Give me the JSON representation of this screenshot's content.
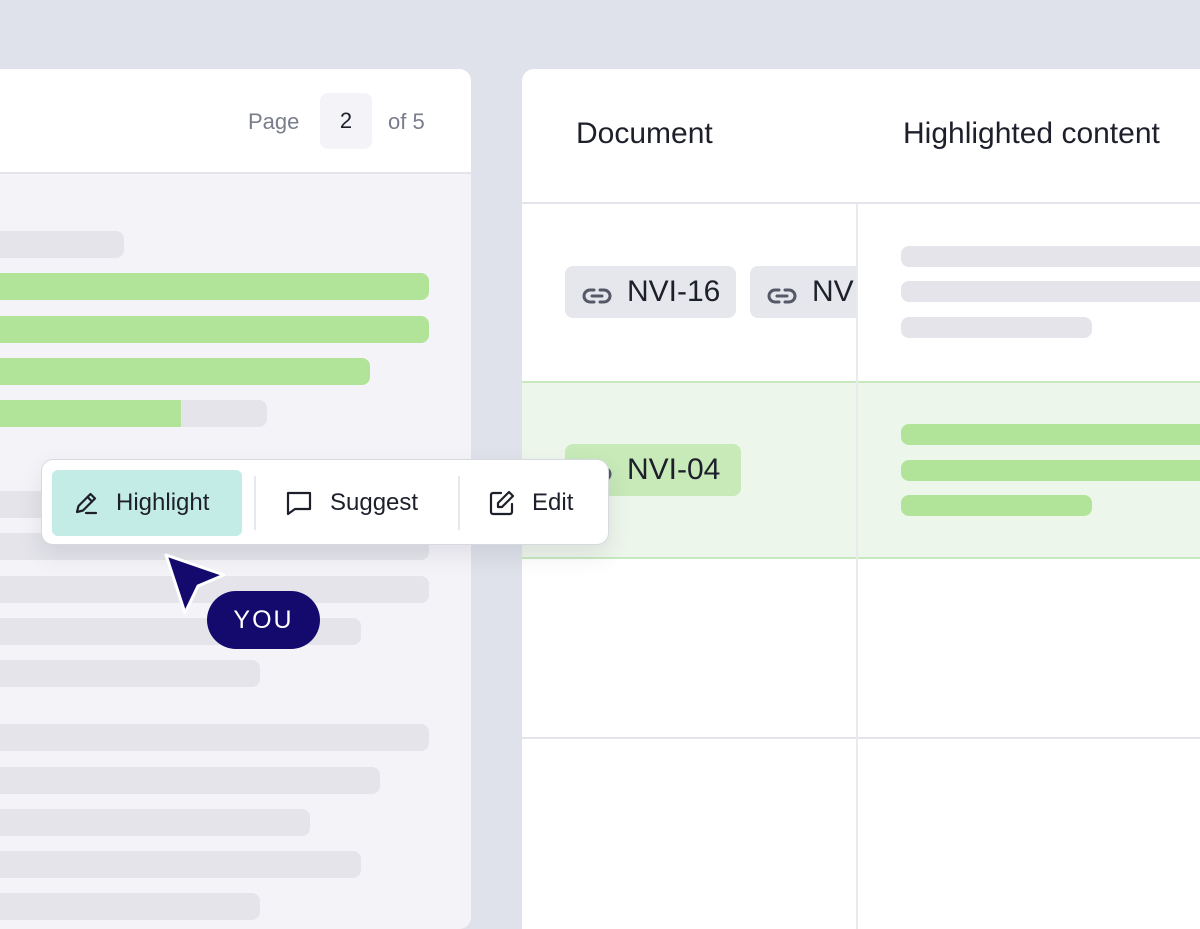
{
  "pager": {
    "page_label": "Page",
    "current_page": "2",
    "of_label": "of 5"
  },
  "table": {
    "columns": [
      "Document",
      "Highlighted content"
    ],
    "rows": [
      {
        "links": [
          "NVI-16",
          "NVI"
        ],
        "highlighted": false
      },
      {
        "links": [
          "NVI-04"
        ],
        "highlighted": true
      },
      {
        "links": [],
        "highlighted": false
      },
      {
        "links": [],
        "highlighted": false
      }
    ]
  },
  "toolbar": {
    "highlight_label": "Highlight",
    "suggest_label": "Suggest",
    "edit_label": "Edit",
    "active": "highlight"
  },
  "cursor": {
    "label": "YOU",
    "color": "#140a6e"
  },
  "colors": {
    "highlight_green": "#b1e398",
    "active_button": "#c4ece7",
    "placeholder_gray": "#e4e4ea"
  }
}
